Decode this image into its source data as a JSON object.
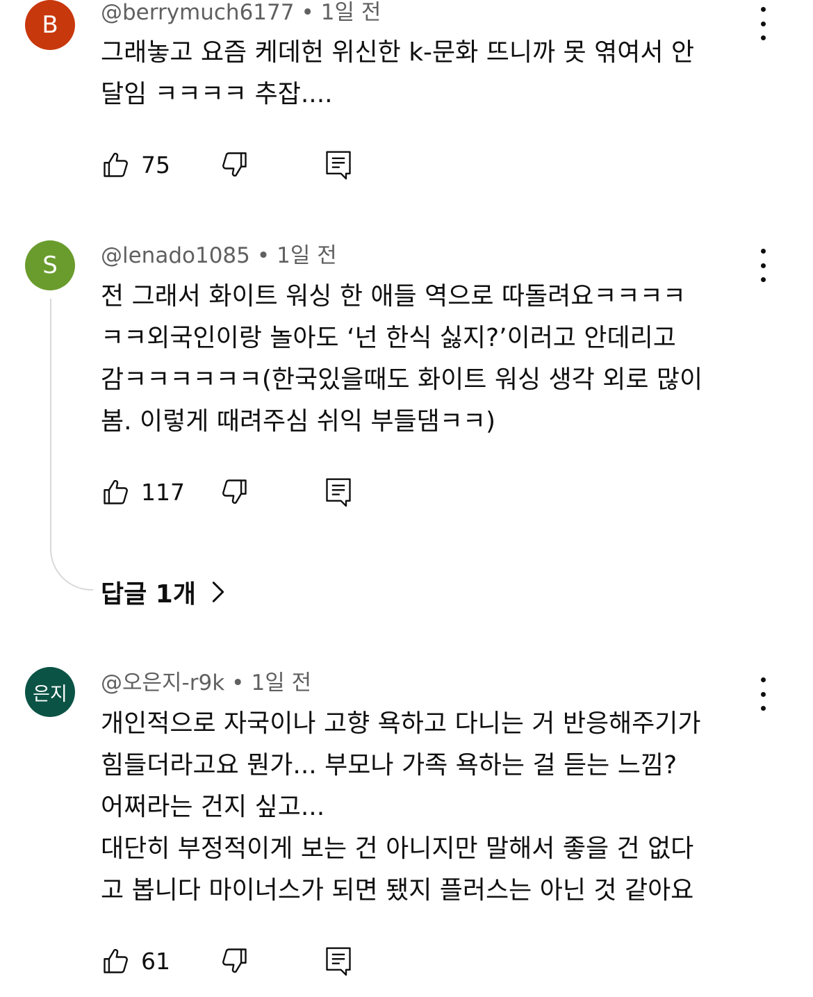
{
  "comments": [
    {
      "avatar_letter": "B",
      "avatar_color": "#c8380d",
      "handle": "@berrymuch6177",
      "separator": "•",
      "time": "1일 전",
      "lines": [
        "그래놓고 요즘 케데헌 위신한 k-문화 뜨니까 못 엮여서 안",
        "달임 ㅋㅋㅋㅋ 추잡...."
      ],
      "likes": "75",
      "icons": {
        "like": "thumb-up-icon",
        "dislike": "thumb-down-icon",
        "reply": "reply-comment-icon",
        "more": "more-vertical-icon"
      }
    },
    {
      "avatar_letter": "S",
      "avatar_color": "#6a9c2d",
      "handle": "@lenado1085",
      "separator": "•",
      "time": "1일 전",
      "lines": [
        "전 그래서 화이트 워싱 한 애들 역으로 따돌려요ㅋㅋㅋㅋ",
        "ㅋㅋ외국인이랑 놀아도 ‘넌 한식 싫지?’이러고 안데리고",
        "감ㅋㅋㅋㅋㅋㅋ(한국있을때도 화이트 워싱 생각 외로 많이",
        "봄. 이렇게 때려주심 쉬익 부들댐ㅋㅋ)"
      ],
      "likes": "117",
      "replies_label": "답글 1개",
      "icons": {
        "like": "thumb-up-icon",
        "dislike": "thumb-down-icon",
        "reply": "reply-comment-icon",
        "more": "more-vertical-icon"
      }
    },
    {
      "avatar_letter": "은지",
      "avatar_color": "#0b5345",
      "handle": "@오은지-r9k",
      "separator": "•",
      "time": "1일 전",
      "lines": [
        "개인적으로 자국이나 고향 욕하고 다니는 거 반응해주기가",
        "힘들더라고요 뭔가... 부모나 가족 욕하는 걸 듣는 느낌?",
        "어쩌라는 건지 싶고...",
        "대단히 부정적이게 보는 건 아니지만 말해서 좋을 건 없다",
        "고 봅니다 마이너스가 되면 됐지 플러스는 아닌 것 같아요"
      ],
      "likes": "61",
      "icons": {
        "like": "thumb-up-icon",
        "dislike": "thumb-down-icon",
        "reply": "reply-comment-icon",
        "more": "more-vertical-icon"
      }
    }
  ]
}
